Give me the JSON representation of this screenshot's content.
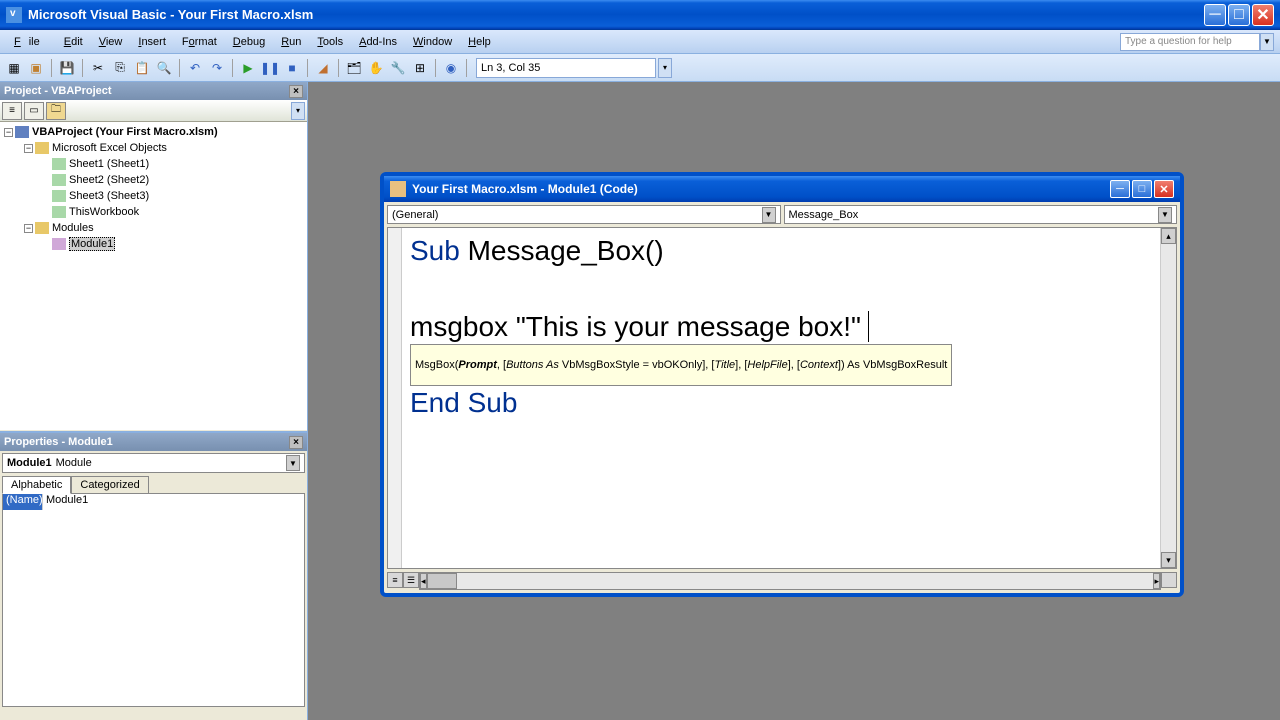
{
  "titlebar": {
    "app_name": "Microsoft Visual Basic",
    "document": "Your First Macro.xlsm",
    "full": "Microsoft Visual Basic - Your First Macro.xlsm"
  },
  "menu": {
    "items": [
      "File",
      "Edit",
      "View",
      "Insert",
      "Format",
      "Debug",
      "Run",
      "Tools",
      "Add-Ins",
      "Window",
      "Help"
    ],
    "search_placeholder": "Type a question for help"
  },
  "toolbar": {
    "status": "Ln 3, Col 35"
  },
  "project_panel": {
    "title": "Project - VBAProject",
    "root": "VBAProject (Your First Macro.xlsm)",
    "excel_group": "Microsoft Excel Objects",
    "sheets": [
      "Sheet1 (Sheet1)",
      "Sheet2 (Sheet2)",
      "Sheet3 (Sheet3)",
      "ThisWorkbook"
    ],
    "modules_group": "Modules",
    "modules": [
      "Module1"
    ]
  },
  "properties_panel": {
    "title": "Properties - Module1",
    "object_name": "Module1",
    "object_type": "Module",
    "tabs": [
      "Alphabetic",
      "Categorized"
    ],
    "rows": [
      {
        "name": "(Name)",
        "value": "Module1"
      }
    ]
  },
  "code_window": {
    "title": "Your First Macro.xlsm - Module1 (Code)",
    "left_select": "(General)",
    "right_select": "Message_Box",
    "line1_kw": "Sub",
    "line1_rest": " Message_Box()",
    "line3": "msgbox \"This is your message box!\"",
    "line5_kw": "End Sub",
    "tooltip": {
      "fn": "MsgBox(",
      "prompt": "Prompt",
      "rest1": ", [",
      "buttons": "Buttons As",
      "rest2": " VbMsgBoxStyle = vbOKOnly], [",
      "title_p": "Title",
      "rest3": "], [",
      "helpfile": "HelpFile",
      "rest4": "], [",
      "context": "Context",
      "rest5": "]) As VbMsgBoxResult"
    }
  }
}
